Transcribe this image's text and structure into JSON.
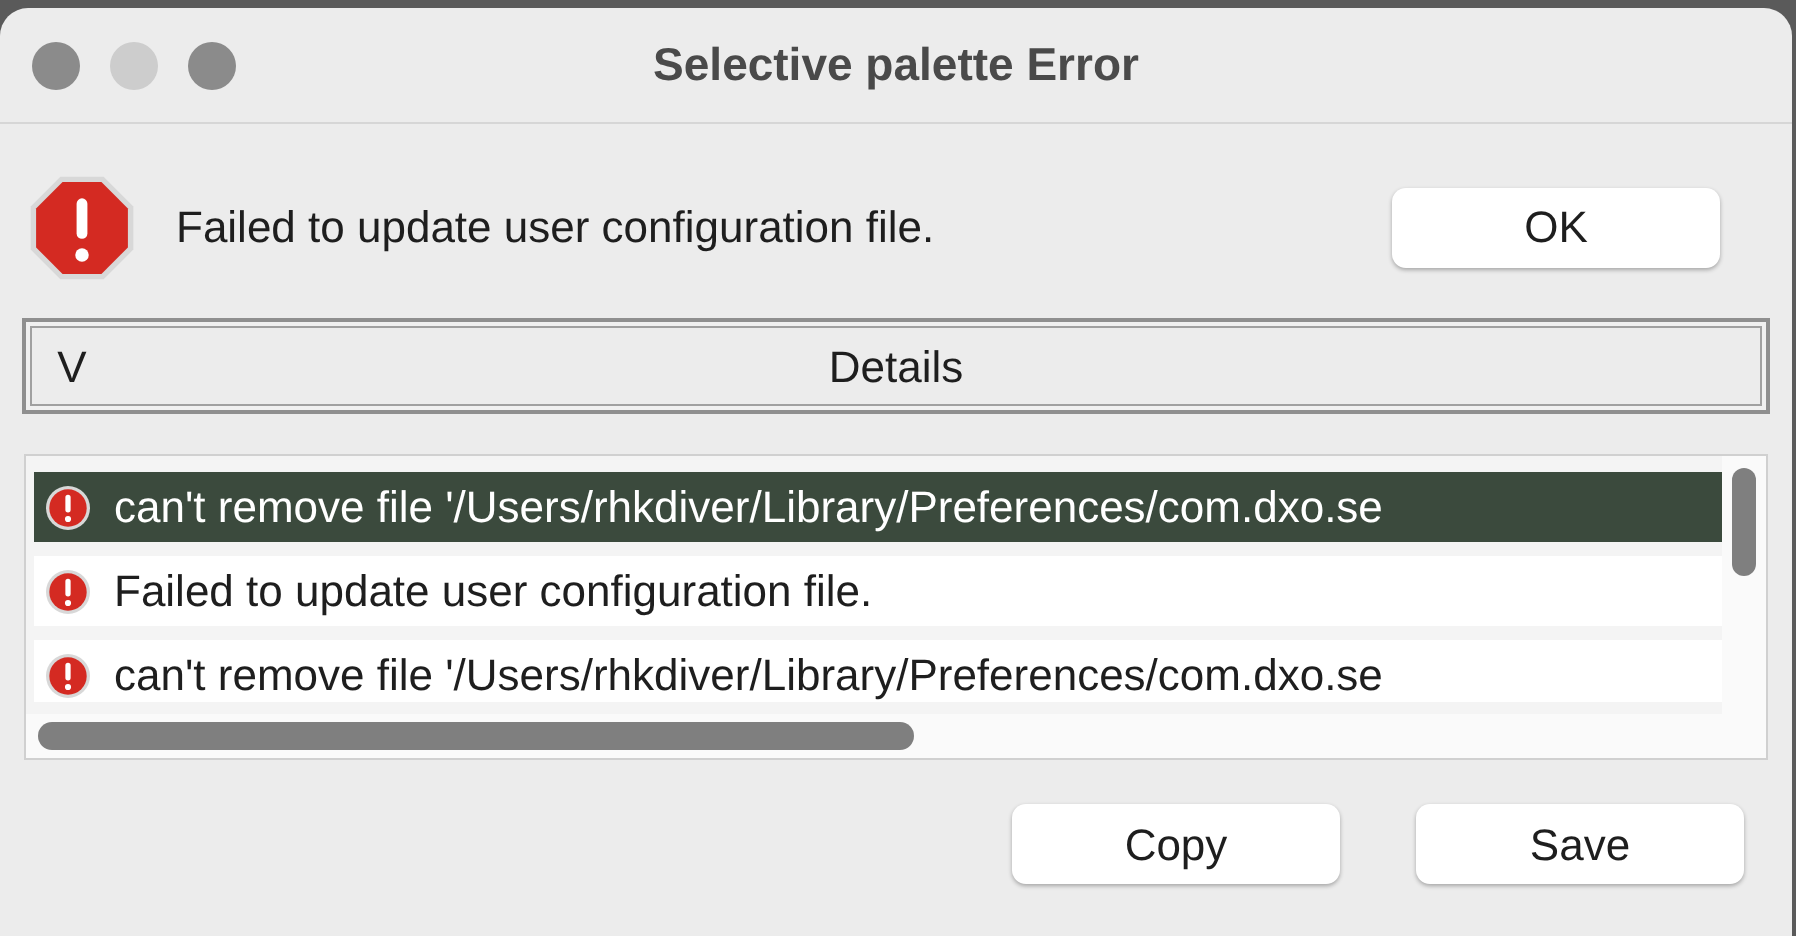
{
  "window": {
    "title": "Selective palette Error"
  },
  "message": "Failed to update user configuration file.",
  "ok_button": "OK",
  "details_toggle": {
    "glyph": "V",
    "label": "Details"
  },
  "details_list": [
    {
      "text": "can't remove file '/Users/rhkdiver/Library/Preferences/com.dxo.se",
      "selected": true
    },
    {
      "text": "Failed to update user configuration file.",
      "selected": false
    },
    {
      "text": "can't remove file '/Users/rhkdiver/Library/Preferences/com.dxo.se",
      "selected": false
    }
  ],
  "buttons": [
    "Copy",
    "Save"
  ]
}
